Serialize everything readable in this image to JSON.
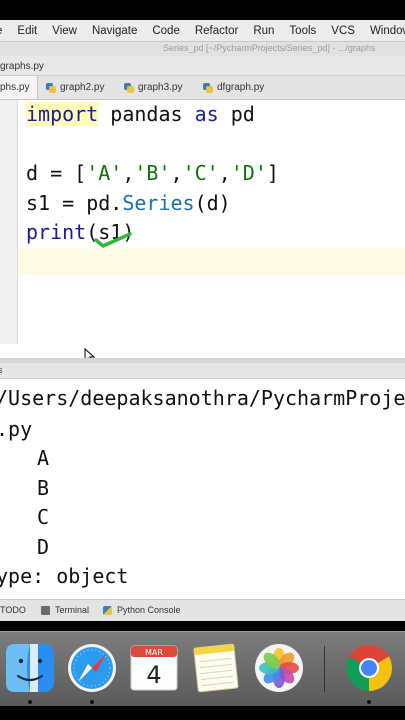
{
  "menu": [
    "e",
    "Edit",
    "View",
    "Navigate",
    "Code",
    "Refactor",
    "Run",
    "Tools",
    "VCS",
    "Window"
  ],
  "window_title": "Series_pd [~/PycharmProjects/Series_pd] - .../graphs",
  "nav_path": "graphs.py",
  "tabs": [
    {
      "label": "phs.py",
      "active": true
    },
    {
      "label": "graph2.py",
      "active": false
    },
    {
      "label": "graph3.py",
      "active": false
    },
    {
      "label": "dfgraph.py",
      "active": false
    }
  ],
  "code": {
    "l1": {
      "k1": "import",
      "t1": " pandas ",
      "k2": "as",
      "t2": " pd"
    },
    "l2": {
      "t1": "d = [",
      "s1": "'A'",
      "c1": ",",
      "s2": "'B'",
      "c2": ",",
      "s3": "'C'",
      "c3": ",",
      "s4": "'D'",
      "t2": "]"
    },
    "l3": {
      "t1": "s1 = pd.",
      "f1": "Series",
      "t2": "(d)"
    },
    "l4": {
      "f1": "print",
      "t1": "(s1)"
    }
  },
  "run_header": "s",
  "console": {
    "path": "/Users/deepaksanothra/PycharmProje",
    "file": ".py",
    "items": [
      "A",
      "B",
      "C",
      "D"
    ],
    "dtype": "ype: object"
  },
  "tool_windows": [
    "TODO",
    "Terminal",
    "Python Console"
  ],
  "calendar": {
    "month": "MAR",
    "day": "4"
  },
  "dock_apps": [
    "finder-icon",
    "safari-icon",
    "calendar-icon",
    "notes-icon",
    "photos-icon",
    "chrome-icon"
  ]
}
